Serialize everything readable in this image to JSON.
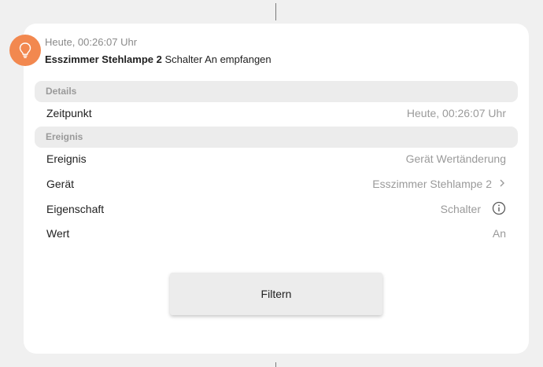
{
  "event": {
    "icon": "lightbulb-icon",
    "time": "Heute, 00:26:07 Uhr",
    "device_name": "Esszimmer Stehlampe 2",
    "action": "Schalter An empfangen"
  },
  "details": {
    "header": "Details",
    "rows": [
      {
        "label": "Zeitpunkt",
        "value": "Heute, 00:26:07 Uhr"
      }
    ]
  },
  "ereignis": {
    "header": "Ereignis",
    "rows": [
      {
        "label": "Ereignis",
        "value": "Gerät Wertänderung"
      },
      {
        "label": "Gerät",
        "value": "Esszimmer Stehlampe 2",
        "icon": "chevron-right-icon"
      },
      {
        "label": "Eigenschaft",
        "value": "Schalter",
        "icon": "info-icon"
      },
      {
        "label": "Wert",
        "value": "An"
      }
    ]
  },
  "filter_button": {
    "label": "Filtern"
  },
  "colors": {
    "accent": "#f2884f",
    "card": "#ffffff",
    "background": "#f0f0f0"
  }
}
